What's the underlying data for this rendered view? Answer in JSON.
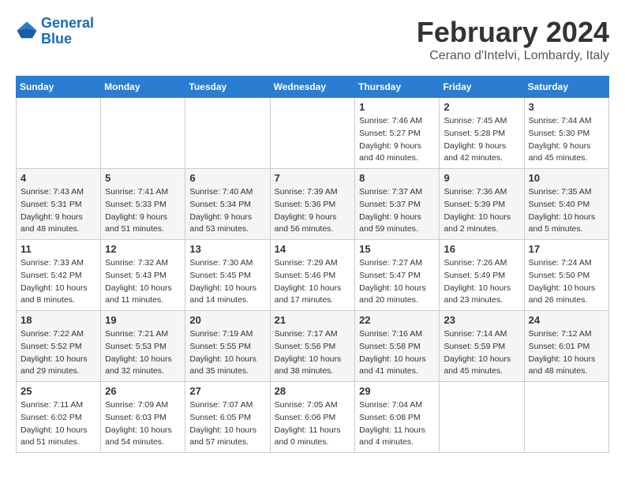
{
  "logo": {
    "line1": "General",
    "line2": "Blue"
  },
  "title": "February 2024",
  "location": "Cerano d'Intelvi, Lombardy, Italy",
  "days_of_week": [
    "Sunday",
    "Monday",
    "Tuesday",
    "Wednesday",
    "Thursday",
    "Friday",
    "Saturday"
  ],
  "weeks": [
    [
      {
        "day": "",
        "sunrise": "",
        "sunset": "",
        "daylight": "",
        "empty": true
      },
      {
        "day": "",
        "sunrise": "",
        "sunset": "",
        "daylight": "",
        "empty": true
      },
      {
        "day": "",
        "sunrise": "",
        "sunset": "",
        "daylight": "",
        "empty": true
      },
      {
        "day": "",
        "sunrise": "",
        "sunset": "",
        "daylight": "",
        "empty": true
      },
      {
        "day": "1",
        "sunrise": "Sunrise: 7:46 AM",
        "sunset": "Sunset: 5:27 PM",
        "daylight": "Daylight: 9 hours and 40 minutes."
      },
      {
        "day": "2",
        "sunrise": "Sunrise: 7:45 AM",
        "sunset": "Sunset: 5:28 PM",
        "daylight": "Daylight: 9 hours and 42 minutes."
      },
      {
        "day": "3",
        "sunrise": "Sunrise: 7:44 AM",
        "sunset": "Sunset: 5:30 PM",
        "daylight": "Daylight: 9 hours and 45 minutes."
      }
    ],
    [
      {
        "day": "4",
        "sunrise": "Sunrise: 7:43 AM",
        "sunset": "Sunset: 5:31 PM",
        "daylight": "Daylight: 9 hours and 48 minutes."
      },
      {
        "day": "5",
        "sunrise": "Sunrise: 7:41 AM",
        "sunset": "Sunset: 5:33 PM",
        "daylight": "Daylight: 9 hours and 51 minutes."
      },
      {
        "day": "6",
        "sunrise": "Sunrise: 7:40 AM",
        "sunset": "Sunset: 5:34 PM",
        "daylight": "Daylight: 9 hours and 53 minutes."
      },
      {
        "day": "7",
        "sunrise": "Sunrise: 7:39 AM",
        "sunset": "Sunset: 5:36 PM",
        "daylight": "Daylight: 9 hours and 56 minutes."
      },
      {
        "day": "8",
        "sunrise": "Sunrise: 7:37 AM",
        "sunset": "Sunset: 5:37 PM",
        "daylight": "Daylight: 9 hours and 59 minutes."
      },
      {
        "day": "9",
        "sunrise": "Sunrise: 7:36 AM",
        "sunset": "Sunset: 5:39 PM",
        "daylight": "Daylight: 10 hours and 2 minutes."
      },
      {
        "day": "10",
        "sunrise": "Sunrise: 7:35 AM",
        "sunset": "Sunset: 5:40 PM",
        "daylight": "Daylight: 10 hours and 5 minutes."
      }
    ],
    [
      {
        "day": "11",
        "sunrise": "Sunrise: 7:33 AM",
        "sunset": "Sunset: 5:42 PM",
        "daylight": "Daylight: 10 hours and 8 minutes."
      },
      {
        "day": "12",
        "sunrise": "Sunrise: 7:32 AM",
        "sunset": "Sunset: 5:43 PM",
        "daylight": "Daylight: 10 hours and 11 minutes."
      },
      {
        "day": "13",
        "sunrise": "Sunrise: 7:30 AM",
        "sunset": "Sunset: 5:45 PM",
        "daylight": "Daylight: 10 hours and 14 minutes."
      },
      {
        "day": "14",
        "sunrise": "Sunrise: 7:29 AM",
        "sunset": "Sunset: 5:46 PM",
        "daylight": "Daylight: 10 hours and 17 minutes."
      },
      {
        "day": "15",
        "sunrise": "Sunrise: 7:27 AM",
        "sunset": "Sunset: 5:47 PM",
        "daylight": "Daylight: 10 hours and 20 minutes."
      },
      {
        "day": "16",
        "sunrise": "Sunrise: 7:26 AM",
        "sunset": "Sunset: 5:49 PM",
        "daylight": "Daylight: 10 hours and 23 minutes."
      },
      {
        "day": "17",
        "sunrise": "Sunrise: 7:24 AM",
        "sunset": "Sunset: 5:50 PM",
        "daylight": "Daylight: 10 hours and 26 minutes."
      }
    ],
    [
      {
        "day": "18",
        "sunrise": "Sunrise: 7:22 AM",
        "sunset": "Sunset: 5:52 PM",
        "daylight": "Daylight: 10 hours and 29 minutes."
      },
      {
        "day": "19",
        "sunrise": "Sunrise: 7:21 AM",
        "sunset": "Sunset: 5:53 PM",
        "daylight": "Daylight: 10 hours and 32 minutes."
      },
      {
        "day": "20",
        "sunrise": "Sunrise: 7:19 AM",
        "sunset": "Sunset: 5:55 PM",
        "daylight": "Daylight: 10 hours and 35 minutes."
      },
      {
        "day": "21",
        "sunrise": "Sunrise: 7:17 AM",
        "sunset": "Sunset: 5:56 PM",
        "daylight": "Daylight: 10 hours and 38 minutes."
      },
      {
        "day": "22",
        "sunrise": "Sunrise: 7:16 AM",
        "sunset": "Sunset: 5:58 PM",
        "daylight": "Daylight: 10 hours and 41 minutes."
      },
      {
        "day": "23",
        "sunrise": "Sunrise: 7:14 AM",
        "sunset": "Sunset: 5:59 PM",
        "daylight": "Daylight: 10 hours and 45 minutes."
      },
      {
        "day": "24",
        "sunrise": "Sunrise: 7:12 AM",
        "sunset": "Sunset: 6:01 PM",
        "daylight": "Daylight: 10 hours and 48 minutes."
      }
    ],
    [
      {
        "day": "25",
        "sunrise": "Sunrise: 7:11 AM",
        "sunset": "Sunset: 6:02 PM",
        "daylight": "Daylight: 10 hours and 51 minutes."
      },
      {
        "day": "26",
        "sunrise": "Sunrise: 7:09 AM",
        "sunset": "Sunset: 6:03 PM",
        "daylight": "Daylight: 10 hours and 54 minutes."
      },
      {
        "day": "27",
        "sunrise": "Sunrise: 7:07 AM",
        "sunset": "Sunset: 6:05 PM",
        "daylight": "Daylight: 10 hours and 57 minutes."
      },
      {
        "day": "28",
        "sunrise": "Sunrise: 7:05 AM",
        "sunset": "Sunset: 6:06 PM",
        "daylight": "Daylight: 11 hours and 0 minutes."
      },
      {
        "day": "29",
        "sunrise": "Sunrise: 7:04 AM",
        "sunset": "Sunset: 6:08 PM",
        "daylight": "Daylight: 11 hours and 4 minutes."
      },
      {
        "day": "",
        "sunrise": "",
        "sunset": "",
        "daylight": "",
        "empty": true
      },
      {
        "day": "",
        "sunrise": "",
        "sunset": "",
        "daylight": "",
        "empty": true
      }
    ]
  ]
}
